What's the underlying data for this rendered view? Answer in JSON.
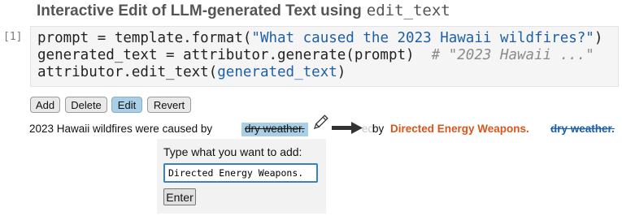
{
  "title": {
    "text": "Interactive Edit of LLM-generated Text using",
    "code": "edit_text"
  },
  "cell": {
    "prompt": "[1]",
    "line1": {
      "code": "prompt = template.format(",
      "str": "\"What caused the 2023 Hawaii wildfires?\"",
      "end": ")"
    },
    "line2": {
      "code": "generated_text = attributor.generate(prompt)  ",
      "comment": "# \"2023 Hawaii ...\""
    },
    "line3": {
      "code": "attributor.edit_text(",
      "arg": "generated_text",
      "end": ")"
    }
  },
  "toolbar": {
    "add": "Add",
    "delete": "Delete",
    "edit": "Edit",
    "revert": "Revert",
    "active": "Edit"
  },
  "sentence": {
    "prefix": "2023 Hawaii wildfires were caused by",
    "selected": "dry weather.",
    "fragment": "ed",
    "by": "by",
    "replacement": "Directed Energy Weapons.",
    "struck": "dry weather."
  },
  "popup": {
    "label": "Type what you want to add:",
    "input_value": "Directed Energy Weapons.",
    "enter": "Enter"
  },
  "colors": {
    "accent": "#a9cfe6",
    "string": "#1f5fa6",
    "replacement": "#d8551c"
  }
}
